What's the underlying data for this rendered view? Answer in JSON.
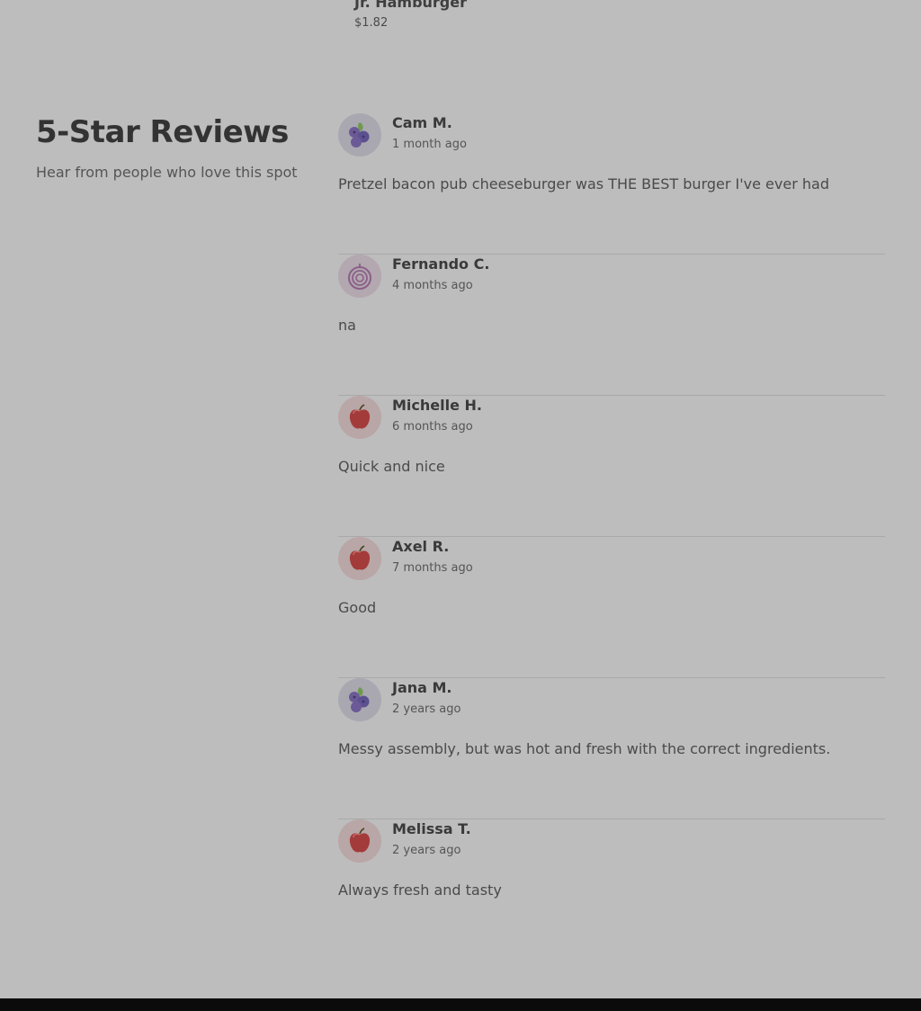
{
  "menu_item": {
    "name": "Jr. Hamburger",
    "price": "$1.82"
  },
  "section": {
    "title": "5-Star Reviews",
    "subtitle": "Hear from people who love this spot"
  },
  "reviews": [
    {
      "avatar": "blueberry-icon",
      "name": "Cam M.",
      "date": "1 month ago",
      "text": "Pretzel bacon pub cheeseburger was THE BEST burger I've ever had"
    },
    {
      "avatar": "onion-icon",
      "name": "Fernando C.",
      "date": "4 months ago",
      "text": "na"
    },
    {
      "avatar": "apple-icon",
      "name": "Michelle H.",
      "date": "6 months ago",
      "text": "Quick and nice"
    },
    {
      "avatar": "apple-icon",
      "name": "Axel R.",
      "date": "7 months ago",
      "text": "Good"
    },
    {
      "avatar": "blueberry-icon",
      "name": "Jana M.",
      "date": "2 years ago",
      "text": "Messy assembly, but was hot and fresh with the correct ingredients."
    },
    {
      "avatar": "apple-icon",
      "name": "Melissa T.",
      "date": "2 years ago",
      "text": "Always fresh and tasty"
    }
  ]
}
